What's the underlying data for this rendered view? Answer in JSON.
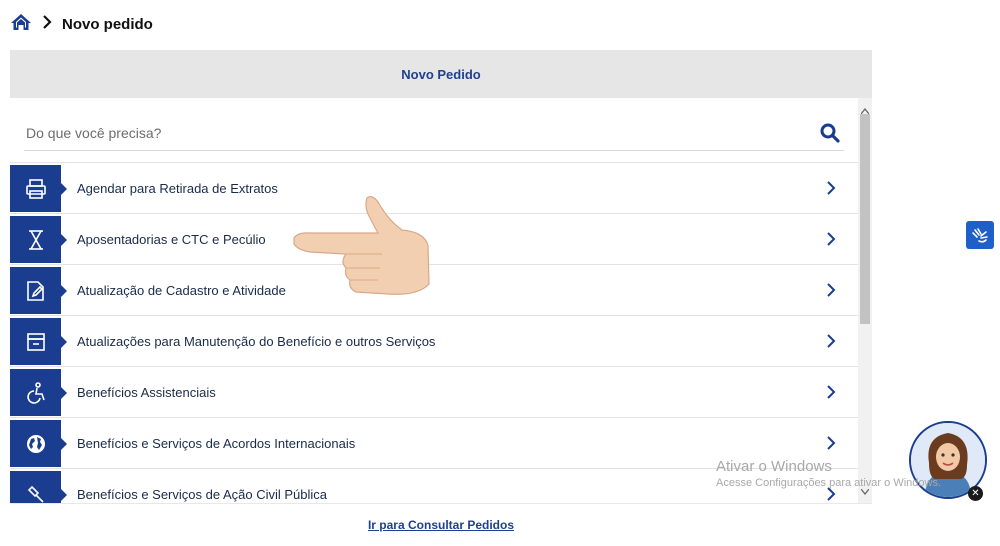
{
  "breadcrumb": {
    "home_icon": "home-icon",
    "separator_icon": "chevron-right-icon",
    "current": "Novo pedido"
  },
  "panel": {
    "title": "Novo Pedido",
    "search": {
      "placeholder": "Do que você precisa?",
      "value": "",
      "icon": "search-icon"
    },
    "items": [
      {
        "label": "Agendar para Retirada de Extratos",
        "icon": "printer-icon"
      },
      {
        "label": "Aposentadorias e CTC e Pecúlio",
        "icon": "hourglass-icon"
      },
      {
        "label": "Atualização de Cadastro e Atividade",
        "icon": "document-edit-icon"
      },
      {
        "label": "Atualizações para Manutenção do Benefício e outros Serviços",
        "icon": "archive-box-icon"
      },
      {
        "label": "Benefícios Assistenciais",
        "icon": "wheelchair-icon"
      },
      {
        "label": "Benefícios e Serviços de Acordos Internacionais",
        "icon": "globe-icon"
      },
      {
        "label": "Benefícios e Serviços de Ação Civil Pública",
        "icon": "gavel-icon"
      }
    ],
    "footer_link": "Ir para Consultar Pedidos"
  },
  "overlay": {
    "pointer": "pointing-hand-icon",
    "accessibility_button": "sign-language-icon",
    "assistant": "assistant-avatar",
    "watermark_title": "Ativar o Windows",
    "watermark_sub": "Acesse Configurações para ativar o Windows."
  },
  "colors": {
    "brand": "#1b3d8f",
    "link": "#1f3f8f",
    "header_bg": "#e6e6e6",
    "a11y": "#1e5fc8"
  }
}
